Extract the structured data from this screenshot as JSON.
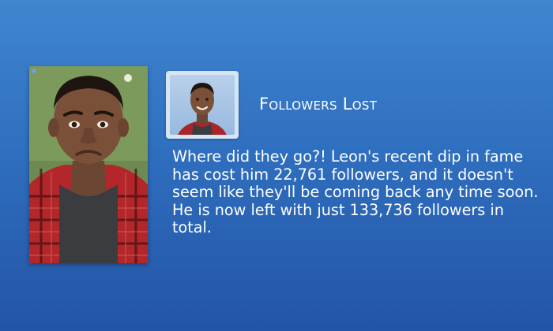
{
  "notification": {
    "title": "Followers Lost",
    "message": "Where did they go?! Leon's recent dip in fame has cost him 22,761 followers, and it doesn't seem like they'll be coming back any time soon. He is now left with just 133,736 followers in total."
  },
  "icons": {
    "portrait": "sad-sim-portrait-icon",
    "thumbnail": "smiling-sim-thumbnail-icon"
  },
  "colors": {
    "background_top": "#3f86cf",
    "background_bottom": "#2454a6",
    "text": "#ffffff",
    "thumbnail_frame": "#d7e5f3"
  }
}
